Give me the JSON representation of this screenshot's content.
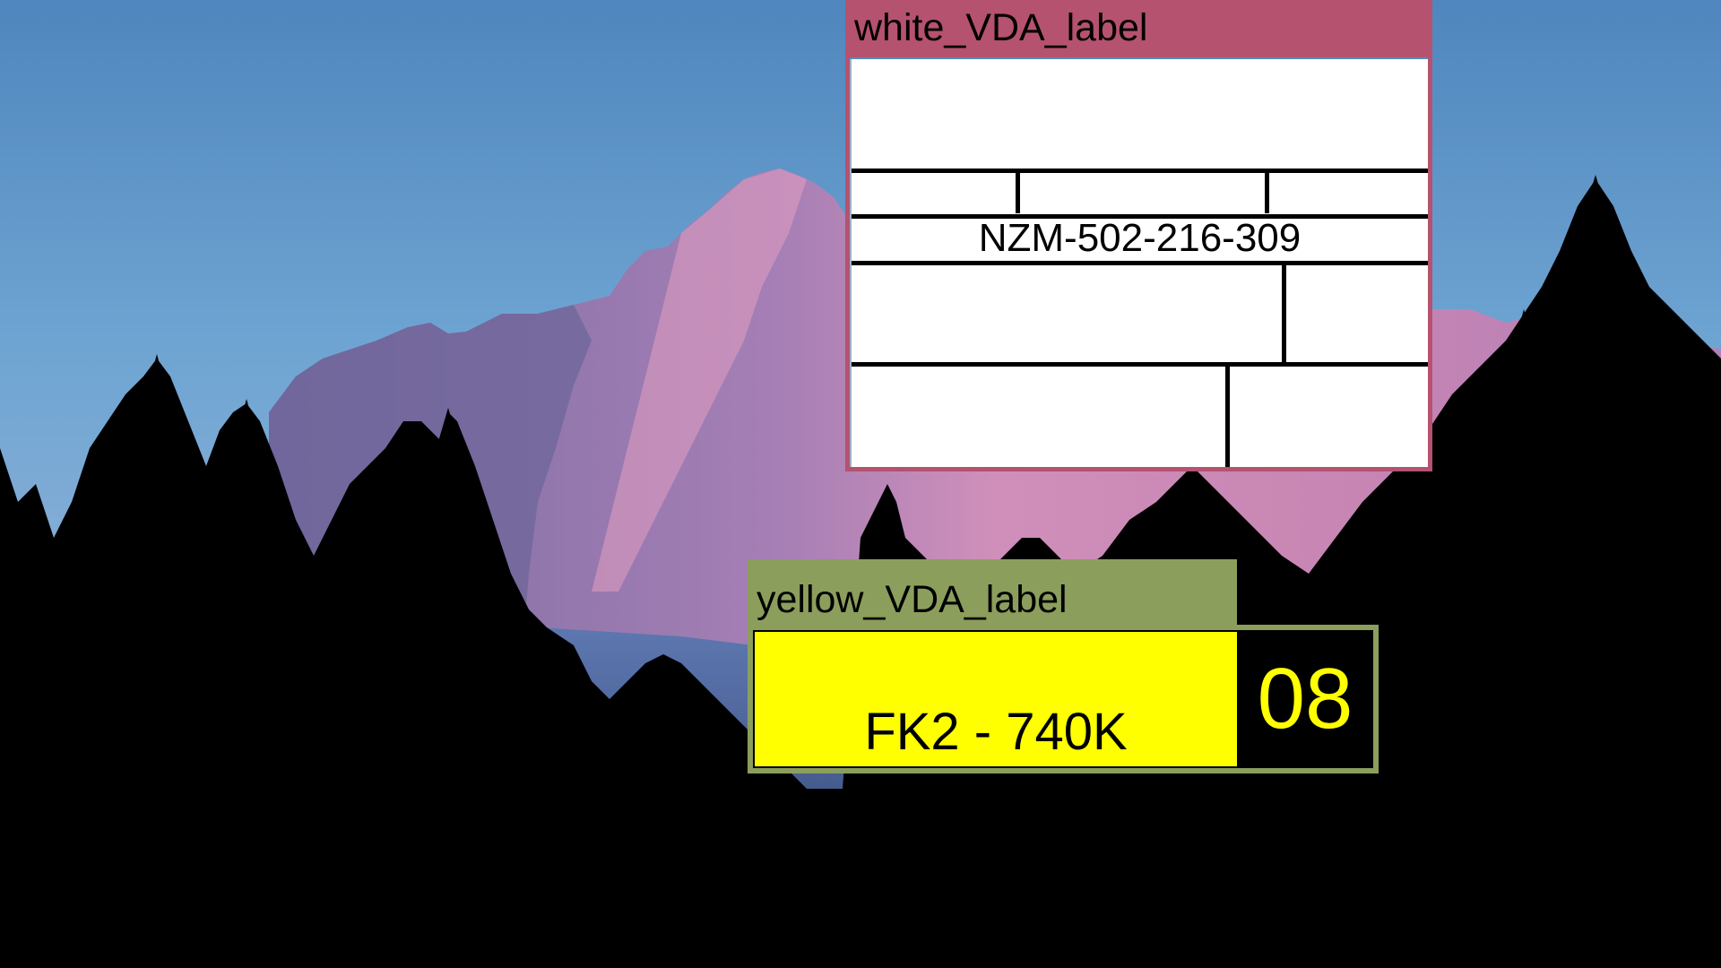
{
  "scene": {
    "colors": {
      "sky_top": "#5f95c9",
      "sky_bottom": "#9db7d6",
      "mountain_lit": "#c77fa6",
      "mountain_shadow": "#7d6b9e",
      "forest": "#000000"
    }
  },
  "white_vda_label": {
    "tag": "white_VDA_label",
    "code": "NZM-502-216-309",
    "tag_color": "#b5526f"
  },
  "yellow_vda_label": {
    "tag": "yellow_VDA_label",
    "code": "FK2 - 740K",
    "number": "08",
    "tag_color": "#8c9e5c",
    "field_color": "#ffff00"
  }
}
